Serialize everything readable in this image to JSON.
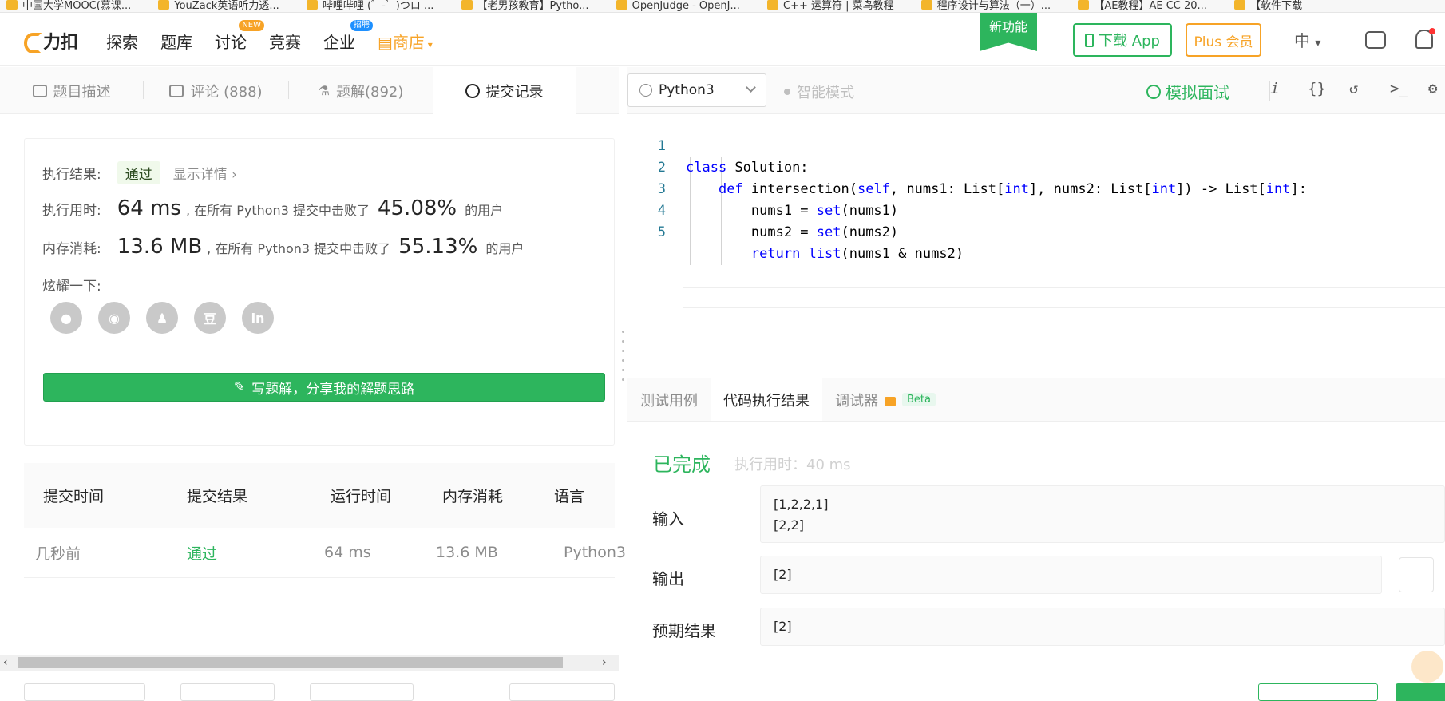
{
  "bookmarks": [
    "中国大学MOOC(慕课...",
    "YouZack英语听力透...",
    "哔哩哔哩 (゜-゜)つロ ...",
    "【老男孩教育】Pytho...",
    "OpenJudge - OpenJ...",
    "C++ 运算符 | 菜鸟教程",
    "程序设计与算法（一）...",
    "【AE教程】AE CC 20...",
    "【软件下载"
  ],
  "nav": {
    "logo": "力扣",
    "items": [
      "探索",
      "题库",
      "讨论",
      "竞赛",
      "企业",
      "商店"
    ],
    "badge_new": "NEW",
    "badge_hire": "招聘",
    "new_feature": "新功能",
    "download_app": "下载 App",
    "plus": "Plus 会员",
    "lang": "中"
  },
  "left_tabs": {
    "desc": "题目描述",
    "comments": "评论 (888)",
    "solutions": "题解(892)",
    "submissions": "提交记录"
  },
  "result": {
    "exec_label": "执行结果:",
    "pass": "通过",
    "detail": "显示详情 ›",
    "time_label": "执行用时:",
    "time_value": "64 ms",
    "beat_text": ", 在所有 Python3 提交中击败了",
    "time_pct": "45.08%",
    "users": "的用户",
    "mem_label": "内存消耗:",
    "mem_value": "13.6 MB",
    "mem_pct": "55.13%",
    "share_label": "炫耀一下:",
    "share_icons": [
      "wechat",
      "weibo",
      "qq",
      "豆",
      "in"
    ],
    "write_btn": "写题解，分享我的解题思路"
  },
  "submissions": {
    "headers": [
      "提交时间",
      "提交结果",
      "运行时间",
      "内存消耗",
      "语言"
    ],
    "rows": [
      {
        "time": "几秒前",
        "result": "通过",
        "runtime": "64 ms",
        "memory": "13.6 MB",
        "lang": "Python3"
      }
    ]
  },
  "editor": {
    "language": "Python3",
    "smart_mode": "智能模式",
    "mock_interview": "模拟面试",
    "lines": [
      "class Solution:",
      "    def intersection(self, nums1: List[int], nums2: List[int]) -> List[int]:",
      "        nums1 = set(nums1)",
      "        nums2 = set(nums2)",
      "        return list(nums1 & nums2)"
    ]
  },
  "run": {
    "tabs": [
      "测试用例",
      "代码执行结果",
      "调试器"
    ],
    "beta": "Beta",
    "status": "已完成",
    "time": "执行用时：40 ms",
    "input_label": "输入",
    "input_value": "[1,2,2,1]\n[2,2]",
    "output_label": "输出",
    "output_value": "[2]",
    "expected_label": "预期结果",
    "expected_value": "[2]"
  },
  "colors": {
    "brand_green": "#2db55d",
    "brand_orange": "#f7a326"
  }
}
